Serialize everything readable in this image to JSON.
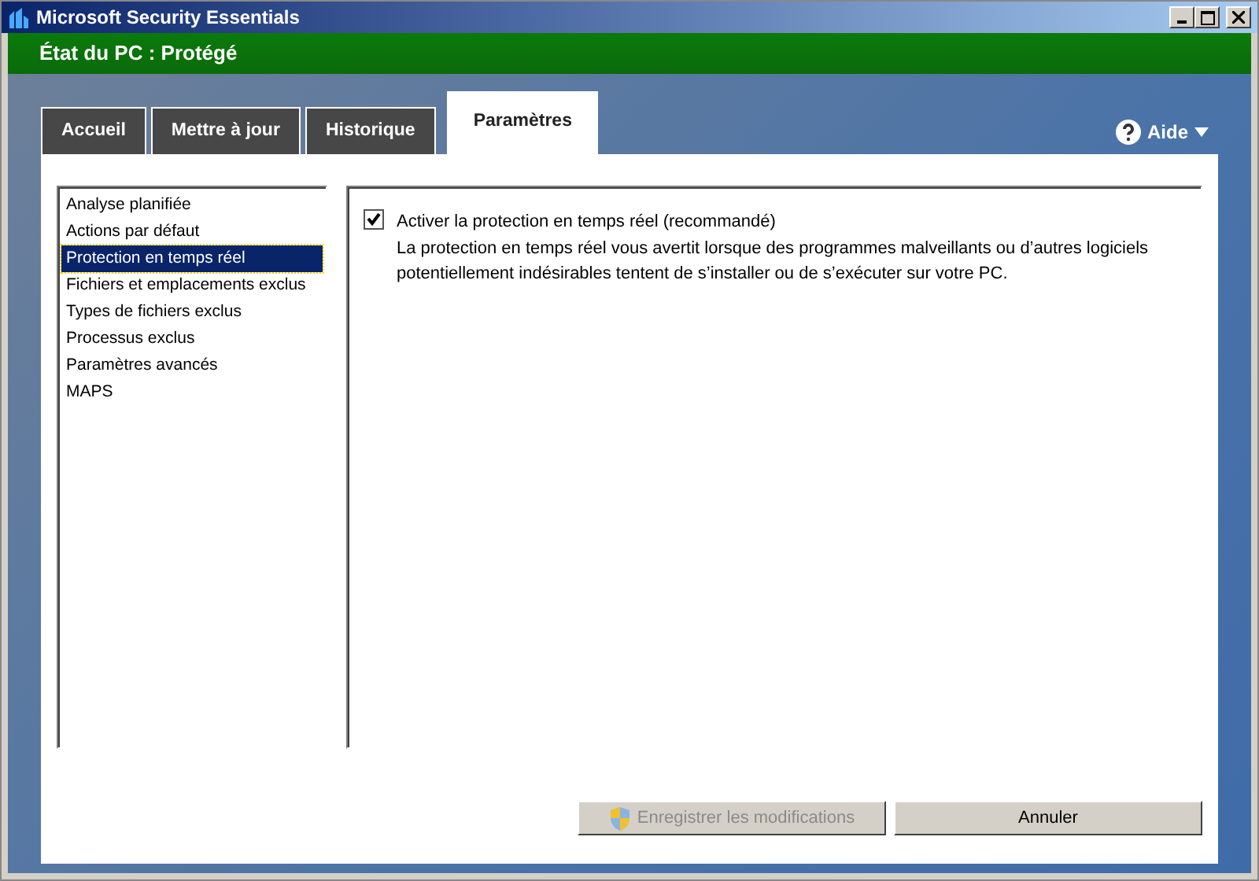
{
  "window": {
    "title": "Microsoft Security Essentials"
  },
  "status": {
    "text": "État du PC : Protégé"
  },
  "tabs": [
    {
      "label": "Accueil",
      "selected": false
    },
    {
      "label": "Mettre à jour",
      "selected": false
    },
    {
      "label": "Historique",
      "selected": false
    },
    {
      "label": "Paramètres",
      "selected": true
    }
  ],
  "help": {
    "label": "Aide"
  },
  "sidebar": {
    "items": [
      {
        "label": "Analyse planifiée",
        "selected": false
      },
      {
        "label": "Actions par défaut",
        "selected": false
      },
      {
        "label": "Protection en temps réel",
        "selected": true
      },
      {
        "label": "Fichiers et emplacements exclus",
        "selected": false
      },
      {
        "label": "Types de fichiers exclus",
        "selected": false
      },
      {
        "label": "Processus exclus",
        "selected": false
      },
      {
        "label": "Paramètres avancés",
        "selected": false
      },
      {
        "label": "MAPS",
        "selected": false
      }
    ]
  },
  "setting": {
    "label": "Activer la protection en temps réel (recommandé)",
    "checked": true,
    "description": "La protection en temps réel vous avertit lorsque des programmes malveillants ou d’autres logiciels potentiellement indésirables tentent de s’installer ou de s’exécuter sur votre PC."
  },
  "buttons": [
    {
      "label": "Enregistrer les modifications",
      "disabled": true,
      "kind": "shield"
    },
    {
      "label": "Annuler",
      "disabled": false,
      "kind": "plain"
    }
  ]
}
